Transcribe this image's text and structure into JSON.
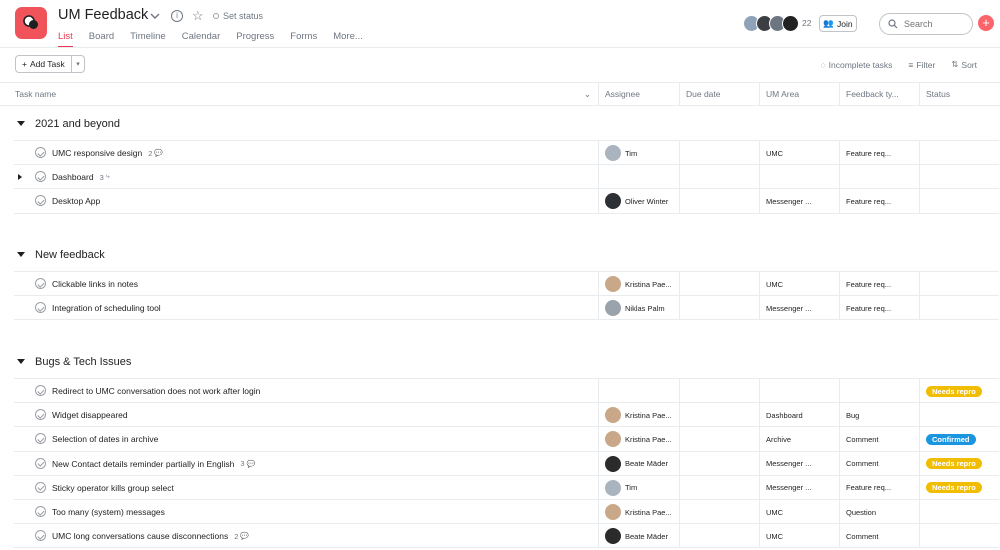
{
  "header": {
    "title": "UM Feedback",
    "set_status": "Set status",
    "tabs": [
      "List",
      "Board",
      "Timeline",
      "Calendar",
      "Progress",
      "Forms",
      "More..."
    ],
    "member_count": "22",
    "join_label": "Join",
    "search_placeholder": "Search",
    "brand_color": "#f0535a"
  },
  "toolbar": {
    "add_task": "Add Task",
    "incomplete": "Incomplete tasks",
    "filter": "Filter",
    "sort": "Sort"
  },
  "columns": [
    "Task name",
    "Assignee",
    "Due date",
    "UM Area",
    "Feedback ty...",
    "Status"
  ],
  "sections": [
    {
      "title": "2021 and beyond",
      "rows": [
        {
          "name": "UMC responsive design",
          "sub": "2",
          "sub_icon": "comment-icon",
          "assignee": "Tim",
          "area": "UMC",
          "type": "Feature req...",
          "status": ""
        },
        {
          "name": "Dashboard",
          "sub": "3",
          "sub_icon": "subtask-icon",
          "assignee": "",
          "area": "",
          "type": "",
          "status": ""
        },
        {
          "name": "Desktop App",
          "sub": "",
          "assignee": "Oliver Winter",
          "area": "Messenger ...",
          "type": "Feature req...",
          "status": ""
        }
      ]
    },
    {
      "title": "New feedback",
      "rows": [
        {
          "name": "Clickable links in notes",
          "sub": "",
          "assignee": "Kristina Pae...",
          "area": "UMC",
          "type": "Feature req...",
          "status": ""
        },
        {
          "name": "Integration of scheduling tool",
          "sub": "",
          "assignee": "Niklas Palm",
          "area": "Messenger ...",
          "type": "Feature req...",
          "status": ""
        }
      ]
    },
    {
      "title": "Bugs & Tech Issues",
      "rows": [
        {
          "name": "Redirect to UMC conversation does not work after login",
          "sub": "",
          "assignee": "",
          "area": "",
          "type": "",
          "status": "Needs repro"
        },
        {
          "name": "Widget disappeared",
          "sub": "",
          "assignee": "Kristina Pae...",
          "area": "Dashboard",
          "type": "Bug",
          "status": ""
        },
        {
          "name": "Selection of dates in archive",
          "sub": "",
          "assignee": "Kristina Pae...",
          "area": "Archive",
          "type": "Comment",
          "status": "Confirmed"
        },
        {
          "name": "New Contact details reminder partially in English",
          "sub": "3",
          "sub_icon": "comment-icon",
          "assignee": "Beate Mäder",
          "area": "Messenger ...",
          "type": "Comment",
          "status": "Needs repro"
        },
        {
          "name": "Sticky operator kills group select",
          "sub": "",
          "assignee": "Tim",
          "area": "Messenger ...",
          "type": "Feature req...",
          "status": "Needs repro"
        },
        {
          "name": "Too many (system) messages",
          "sub": "",
          "assignee": "Kristina Pae...",
          "area": "UMC",
          "type": "Question",
          "status": ""
        },
        {
          "name": "UMC long conversations cause disconnections",
          "sub": "2",
          "sub_icon": "comment-icon",
          "assignee": "Beate Mäder",
          "area": "UMC",
          "type": "Comment",
          "status": ""
        }
      ]
    }
  ],
  "status_colors": {
    "Needs repro": "#f1bd00",
    "Confirmed": "#1a96e0"
  }
}
